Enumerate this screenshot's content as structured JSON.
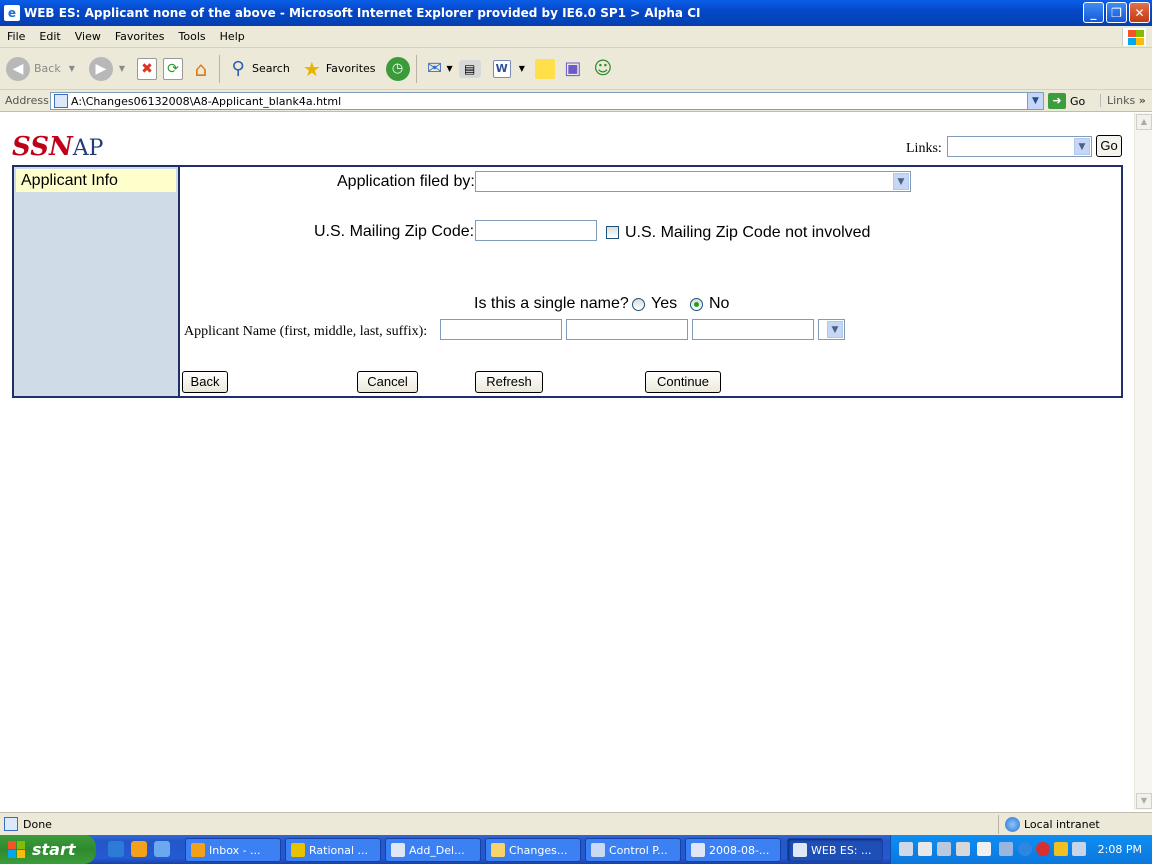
{
  "window": {
    "title": "WEB ES: Applicant none of the above - Microsoft Internet Explorer provided by IE6.0 SP1  > Alpha CI",
    "minimize": "_",
    "maximize": "❐",
    "close": "✕"
  },
  "menu": [
    "File",
    "Edit",
    "View",
    "Favorites",
    "Tools",
    "Help"
  ],
  "toolbar": {
    "back": "Back",
    "search": "Search",
    "favorites": "Favorites"
  },
  "address": {
    "label": "Address",
    "url": "A:\\Changes06132008\\A8-Applicant_blank4a.html",
    "go": "Go",
    "links": "Links"
  },
  "page": {
    "logo_ssn": "SSN",
    "logo_ap": "AP",
    "links_label": "Links:",
    "links_go": "Go",
    "sidebar_item": "Applicant Info",
    "filed_by_label": "Application filed by:",
    "zip_label": "U.S. Mailing Zip Code:",
    "zip_value": "",
    "zip_not_involved": "U.S. Mailing Zip Code not involved",
    "single_name_q": "Is this a single name?",
    "yes": "Yes",
    "no": "No",
    "single_name_selected": "No",
    "applicant_name_label": "Applicant Name (first, middle, last, suffix):",
    "buttons": {
      "back": "Back",
      "cancel": "Cancel",
      "refresh": "Refresh",
      "continue": "Continue"
    }
  },
  "status": {
    "text": "Done",
    "zone": "Local intranet"
  },
  "taskbar": {
    "start": "start",
    "tasks": [
      "Inbox - ...",
      "Rational ...",
      "Add_Del...",
      "Changes...",
      "Control P...",
      "2008-08-...",
      "WEB ES: ..."
    ],
    "clock": "2:08 PM"
  },
  "colors": {
    "title_blue": "#0648c8",
    "logo_red": "#c00018",
    "logo_blue": "#243b7a",
    "frame_border": "#1f2f6a",
    "sidebar_bg": "#cfdbe6",
    "sidebar_item_bg": "#ffffcc"
  }
}
